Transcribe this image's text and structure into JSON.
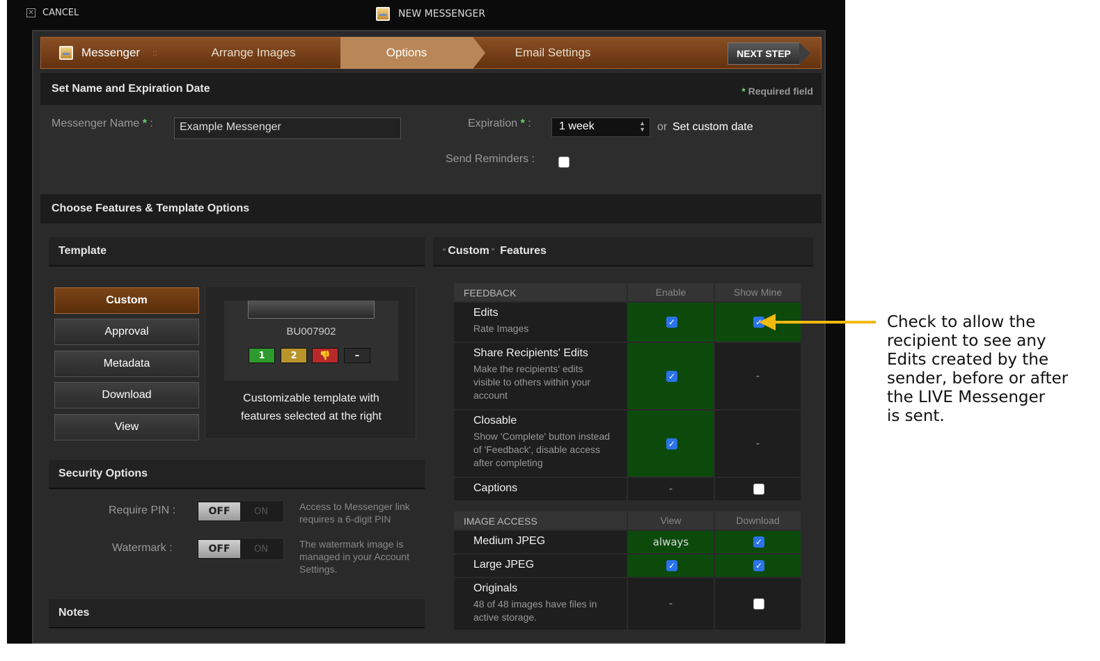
{
  "topbar": {
    "cancel": "CANCEL",
    "title": "NEW MESSENGER"
  },
  "steps": {
    "messenger": "Messenger",
    "sep": "::",
    "arrange": "Arrange Images",
    "options": "Options",
    "email": "Email Settings",
    "next": "NEXT STEP"
  },
  "name_section": {
    "title": "Set Name and Expiration Date",
    "required_star": "*",
    "required": "Required field",
    "name_label": "Messenger Name",
    "star": "*",
    "colon": ":",
    "name_value": "Example Messenger",
    "exp_label": "Expiration",
    "exp_value": "1 week",
    "or": "or",
    "custom_date": "Set custom date",
    "reminders_label": "Send Reminders :"
  },
  "features_section": {
    "title": "Choose Features & Template Options"
  },
  "template": {
    "title": "Template",
    "buttons": [
      "Custom",
      "Approval",
      "Metadata",
      "Download",
      "View"
    ],
    "preview_id": "BU007902",
    "ratings": [
      "1",
      "2",
      "👎",
      "–"
    ],
    "caption_line1": "Customizable template with",
    "caption_line2": "features selected at the right"
  },
  "security": {
    "title": "Security Options",
    "pin_label": "Require PIN :",
    "pin_off": "OFF",
    "pin_on": "ON",
    "pin_desc1": "Access to Messenger link",
    "pin_desc2": "requires a 6-digit PIN",
    "wm_label": "Watermark :",
    "wm_off": "OFF",
    "wm_on": "ON",
    "wm_desc1": "The watermark image is",
    "wm_desc2": "managed in your Account",
    "wm_desc3": "Settings."
  },
  "notes": {
    "title": "Notes"
  },
  "custom_features": {
    "q1": "“",
    "word": "Custom",
    "q2": "”",
    "title": "Features"
  },
  "feedback": {
    "header": "FEEDBACK",
    "col1": "Enable",
    "col2": "Show Mine",
    "rows": [
      {
        "title": "Edits",
        "sub": "Rate Images"
      },
      {
        "title": "Share Recipients' Edits",
        "sub1": "Make the recipients' edits",
        "sub2": "visible to others within your",
        "sub3": "account",
        "dash": "-"
      },
      {
        "title": "Closable",
        "sub1": "Show 'Complete' button instead",
        "sub2": "of 'Feedback', disable access",
        "sub3": "after completing",
        "dash": "-"
      },
      {
        "title": "Captions",
        "dash": "-"
      }
    ]
  },
  "image_access": {
    "header": "IMAGE ACCESS",
    "col1": "View",
    "col2": "Download",
    "rows": [
      {
        "title": "Medium JPEG",
        "view": "always"
      },
      {
        "title": "Large JPEG"
      },
      {
        "title": "Originals",
        "sub1": "48 of 48 images have files in",
        "sub2": "active storage.",
        "dash": "-"
      }
    ]
  },
  "annotation": {
    "l1": "Check to allow the",
    "l2": "recipient to see any",
    "l3": "Edits created by the",
    "l4": "sender, before or after",
    "l5": "the LIVE Messenger",
    "l6": "is sent."
  },
  "colors": {
    "accent_orange": "#b98757",
    "enabled_green": "#0c4a0c",
    "checkbox_blue": "#2a73e8",
    "arrow_yellow": "#f2b90f"
  }
}
